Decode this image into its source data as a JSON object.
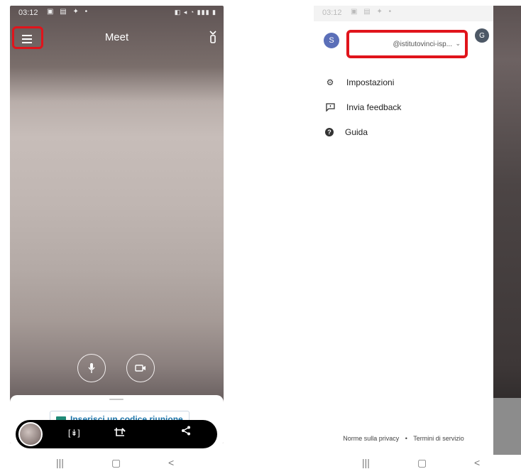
{
  "left": {
    "status": {
      "time": "03:12",
      "notif_icons": "▣ ▤ ✦ •",
      "system_icons": "◧ ◂ ◔ ▮▮▮ ▮"
    },
    "app_title": "Meet",
    "bottom_sheet": {
      "code_button_label": "Inserisci un codice riunione"
    }
  },
  "right": {
    "status": {
      "time": "03:12",
      "notif_icons": "▣ ▤ ✦ •"
    },
    "account": {
      "avatar_letter": "S",
      "email": "@istitutovinci-isp...",
      "secondary_avatar_letter": "G"
    },
    "menu": [
      {
        "label": "Impostazioni",
        "icon": "gear-icon"
      },
      {
        "label": "Invia feedback",
        "icon": "feedback-icon"
      },
      {
        "label": "Guida",
        "icon": "help-icon"
      }
    ],
    "footer": {
      "privacy": "Norme sulla privacy",
      "separator": "•",
      "terms": "Termini di servizio"
    }
  },
  "nav": {
    "recents": "|||",
    "home": "▢",
    "back": "<"
  },
  "colors": {
    "highlight_red": "#e0141b",
    "avatar_blue": "#5b6fb8",
    "chip_text": "#1a73a8"
  }
}
